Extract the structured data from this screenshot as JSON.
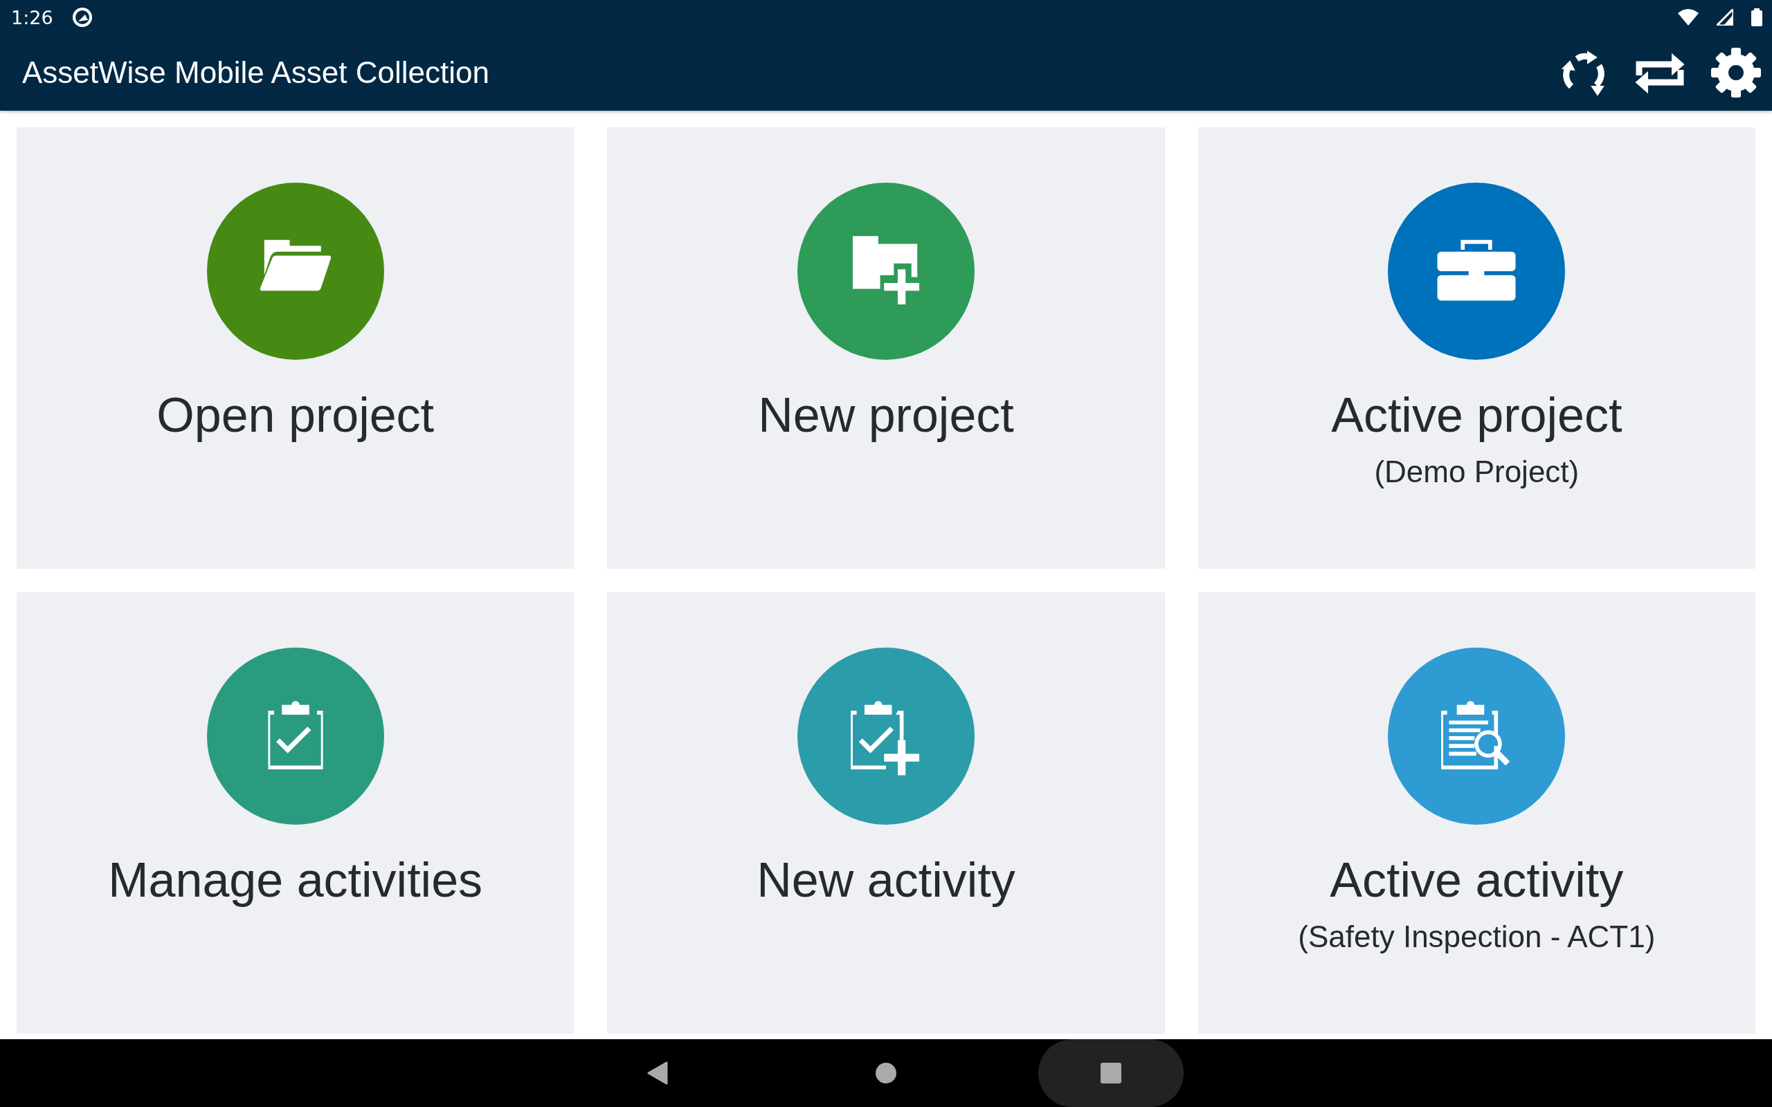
{
  "status_bar": {
    "time": "1:26"
  },
  "app_bar": {
    "title": "AssetWise Mobile Asset Collection"
  },
  "tiles": [
    {
      "kind": "open-folder",
      "title": "Open project",
      "color": "#468a14"
    },
    {
      "kind": "new-folder",
      "title": "New project",
      "color": "#2e9b58"
    },
    {
      "kind": "briefcase",
      "title": "Active project",
      "subtitle": "(Demo Project)",
      "color": "#0071bb"
    },
    {
      "kind": "clipboard-check",
      "title": "Manage activities",
      "color": "#2b9b7f"
    },
    {
      "kind": "clipboard-add",
      "title": "New activity",
      "color": "#2b9ca9"
    },
    {
      "kind": "clipboard-search",
      "title": "Active activity",
      "subtitle": "(Safety Inspection - ACT1)",
      "color": "#2f9bd3"
    }
  ]
}
